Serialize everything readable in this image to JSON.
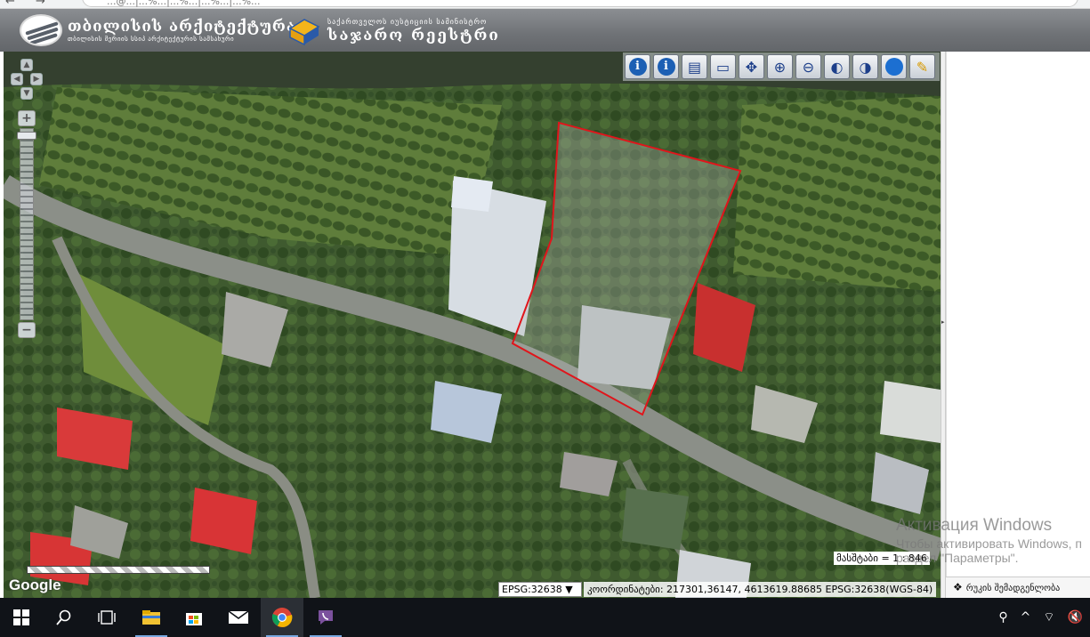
{
  "browser": {
    "back_icon": "back-arrow-icon",
    "forward_icon": "forward-arrow-icon",
    "url_fragment": "...@...|...%...|...%...|...%...|...%..."
  },
  "header": {
    "brand_title": "თბილისის არქიტექტურა",
    "brand_subtitle": "თბილისის მერიის სსიპ არქიტექტურის სამსახური",
    "registry_subtitle": "საქართველოს იუსტიციის სამინისტრო",
    "registry_title": "საჯარო რეესტრი"
  },
  "toolbar": {
    "tools": [
      {
        "name": "info-tool",
        "icon": "info-icon",
        "glyph": "i"
      },
      {
        "name": "identify-tool",
        "icon": "info-down-icon",
        "glyph": "i"
      },
      {
        "name": "measure-area-tool",
        "icon": "measure-area-icon",
        "glyph": "▤"
      },
      {
        "name": "measure-line-tool",
        "icon": "ruler-icon",
        "glyph": "▭"
      },
      {
        "name": "pan-tool",
        "icon": "pan-arrows-icon",
        "glyph": "✥"
      },
      {
        "name": "zoom-in-tool",
        "icon": "zoom-in-icon",
        "glyph": "⊕"
      },
      {
        "name": "zoom-out-tool",
        "icon": "zoom-out-icon",
        "glyph": "⊖"
      },
      {
        "name": "zoom-previous-tool",
        "icon": "zoom-previous-icon",
        "glyph": "◐"
      },
      {
        "name": "zoom-next-tool",
        "icon": "zoom-next-icon",
        "glyph": "◑"
      },
      {
        "name": "full-extent-tool",
        "icon": "globe-icon",
        "glyph": "●"
      },
      {
        "name": "clear-tool",
        "icon": "brush-icon",
        "glyph": "✎"
      }
    ]
  },
  "map": {
    "attribution": "Google",
    "scale_label": "მასშტაბი = 1 : 846",
    "epsg_select": "EPSG:32638",
    "coordinates_label": "კოორდინატები: 217301,36147, 4613619.88685 EPSG:32638(WGS-84)",
    "parcel_outline_color": "#e0151b"
  },
  "layers": {
    "label": "რუკის შემადგენლობა"
  },
  "watermark": {
    "title": "Активация Windows",
    "line1": "Чтобы активировать Windows, п",
    "line2": "раздел \"Параметры\"."
  },
  "taskbar": {
    "apps": [
      "windows-start-icon",
      "search-icon",
      "task-view-icon",
      "file-explorer-icon",
      "store-icon",
      "mail-icon",
      "chrome-icon",
      "viber-icon"
    ],
    "tray": [
      "people-icon",
      "chevron-up-icon",
      "wifi-icon",
      "volume-muted-icon"
    ]
  }
}
